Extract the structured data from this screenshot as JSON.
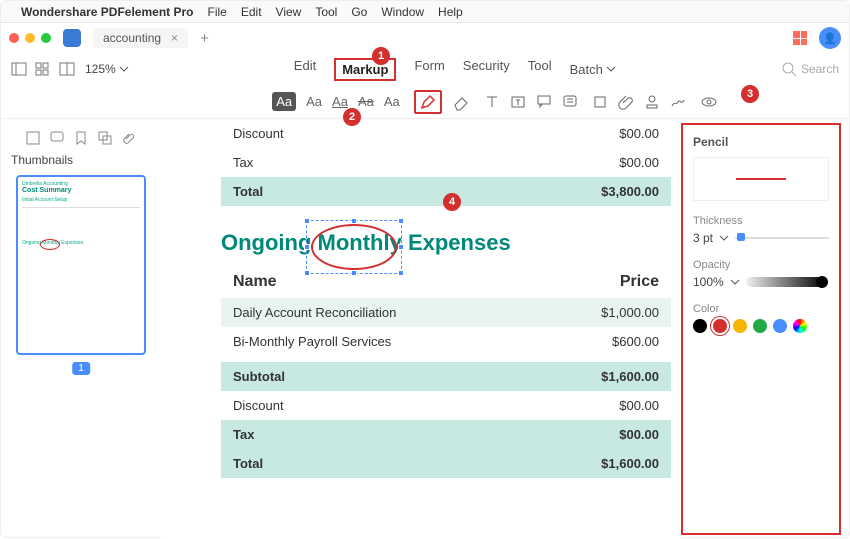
{
  "menubar": {
    "apple": "",
    "appname": "Wondershare PDFelement Pro",
    "items": [
      "File",
      "Edit",
      "View",
      "Tool",
      "Go",
      "Window",
      "Help"
    ]
  },
  "tabrow": {
    "tabname": "accounting",
    "avatar": "👤"
  },
  "toolbar1": {
    "zoom": "125%",
    "center": [
      "Edit",
      "Markup",
      "Form",
      "Security",
      "Tool",
      "Batch"
    ],
    "search_placeholder": "Search"
  },
  "badges": {
    "b1": "1",
    "b2": "2",
    "b3": "3",
    "b4": "4"
  },
  "thumbnails": {
    "label": "Thumbnails",
    "page": "1"
  },
  "doc": {
    "top_rows": [
      {
        "label": "Discount",
        "value": "$00.00"
      },
      {
        "label": "Tax",
        "value": "$00.00"
      }
    ],
    "top_total": {
      "label": "Total",
      "value": "$3,800.00"
    },
    "heading": "Ongoing Monthly Expenses",
    "header": {
      "name": "Name",
      "price": "Price"
    },
    "expense_rows": [
      {
        "name": "Daily Account Reconciliation",
        "price": "$1,000.00",
        "shade": true
      },
      {
        "name": "Bi-Monthly Payroll Services",
        "price": "$600.00",
        "shade": false
      }
    ],
    "summary": [
      {
        "label": "Subtotal",
        "value": "$1,600.00",
        "cls": "head"
      },
      {
        "label": "Discount",
        "value": "$00.00",
        "cls": ""
      },
      {
        "label": "Tax",
        "value": "$00.00",
        "cls": "head"
      },
      {
        "label": "Total",
        "value": "$1,600.00",
        "cls": "total"
      }
    ]
  },
  "panel": {
    "title": "Pencil",
    "thickness_label": "Thickness",
    "thickness_value": "3 pt",
    "opacity_label": "Opacity",
    "opacity_value": "100%",
    "color_label": "Color",
    "colors": [
      "#000000",
      "#d32f2f",
      "#f4b400",
      "#22a847",
      "#4a8dff"
    ]
  },
  "thumb_preview": {
    "sub": "Umbrella Accounting",
    "title": "Cost Summary",
    "section1": "Initial Account Setup",
    "section2_a": "Ongoing ",
    "section2_b": "Monthly",
    "section2_c": " Expenses"
  }
}
